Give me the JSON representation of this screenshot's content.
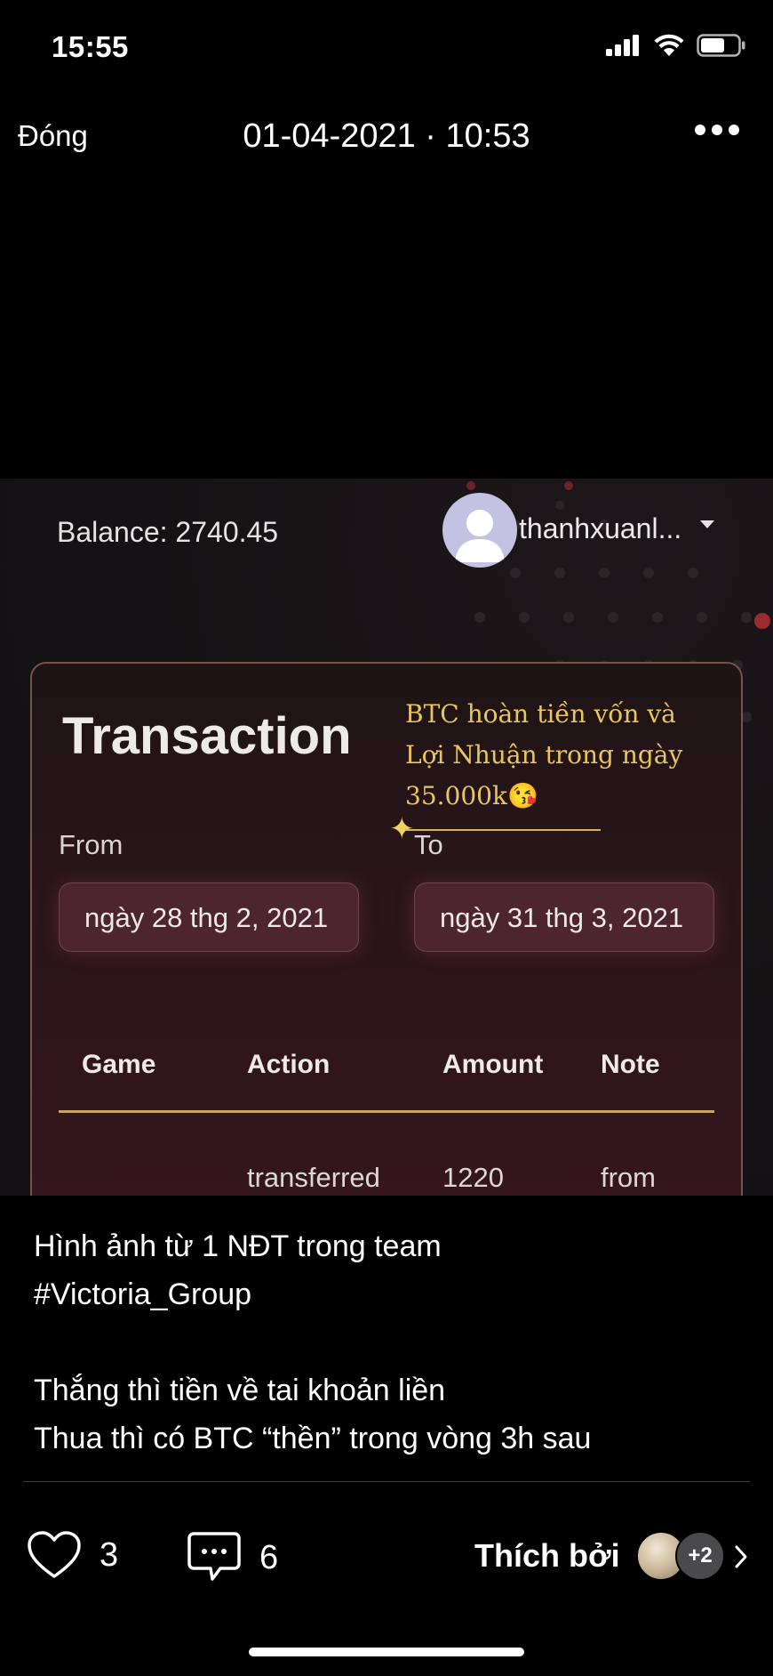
{
  "status": {
    "time": "15:55"
  },
  "header": {
    "close_label": "Đóng",
    "title": "01-04-2021 · 10:53"
  },
  "photo": {
    "balance": "Balance: 2740.45",
    "username": "thanhxuanl...",
    "card": {
      "title": "Transaction",
      "overlay_text": [
        "BTC hoàn tiền vốn và",
        "Lợi Nhuận trong ngày",
        "35.000k😘"
      ],
      "from_label": "From",
      "to_label": "To",
      "from_date": "ngày 28 thg 2, 2021",
      "to_date": "ngày 31 thg 3, 2021",
      "table": {
        "headers": [
          "Game",
          "Action",
          "Amount",
          "Note"
        ],
        "rows": [
          [
            "",
            "transferred",
            "1220",
            "from"
          ]
        ]
      }
    }
  },
  "caption": {
    "lines": [
      "Hình ảnh từ 1 NĐT trong team",
      "#Victoria_Group",
      "",
      "Thắng thì tiền về tai khoản liền",
      "Thua thì có BTC “thền” trong vòng 3h sau"
    ]
  },
  "actions": {
    "like_count": "3",
    "comment_count": "6",
    "liked_by_label": "Thích bởi",
    "more_likers": "+2"
  },
  "colors": {
    "overlay_gold": "#e9c65c",
    "card_border": "#7a5246",
    "date_box": "#4c2530"
  }
}
